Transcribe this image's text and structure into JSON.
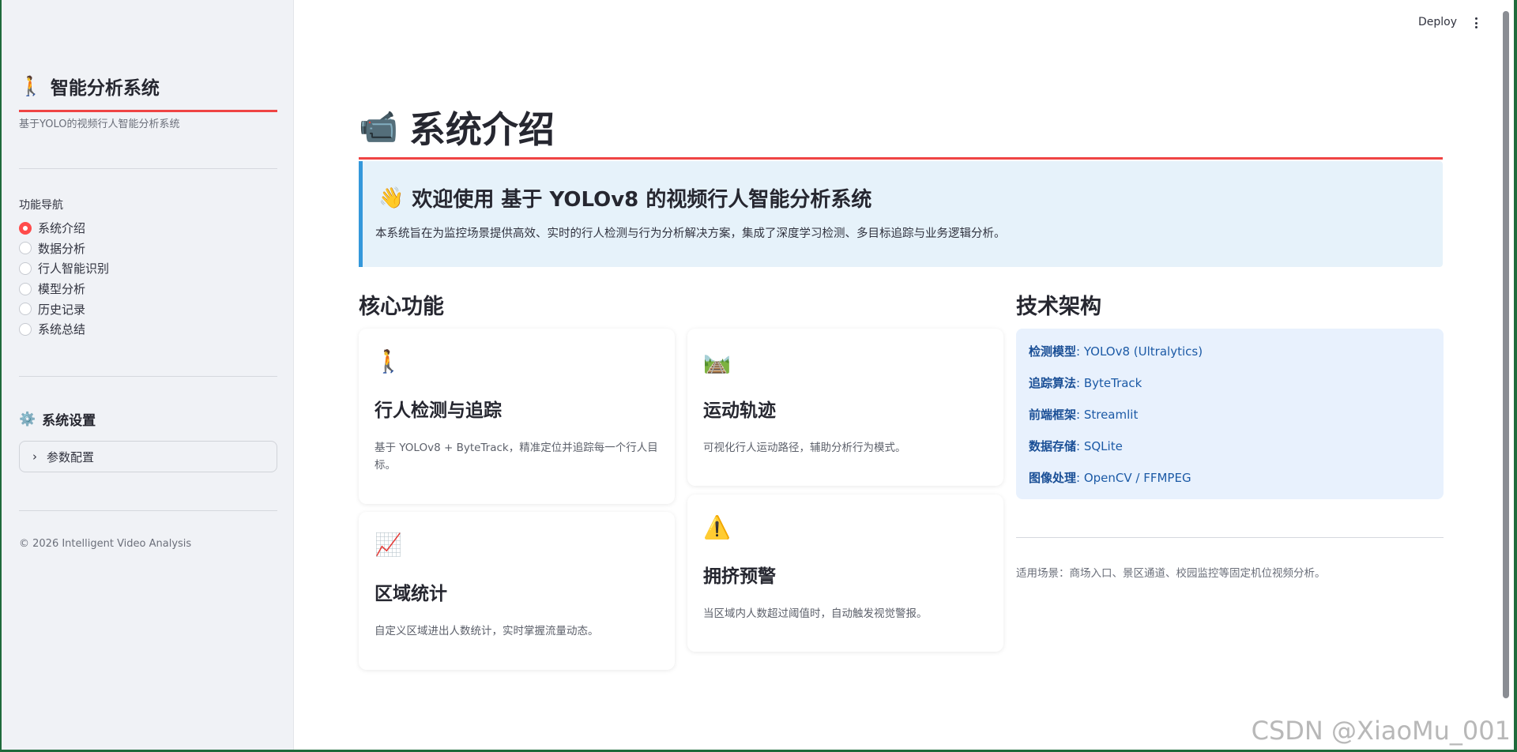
{
  "sidebar": {
    "title_emoji": "🚶",
    "title": "智能分析系统",
    "subtitle": "基于YOLO的视频行人智能分析系统",
    "nav_label": "功能导航",
    "nav_items": [
      {
        "label": "系统介绍",
        "selected": true
      },
      {
        "label": "数据分析",
        "selected": false
      },
      {
        "label": "行人智能识别",
        "selected": false
      },
      {
        "label": "模型分析",
        "selected": false
      },
      {
        "label": "历史记录",
        "selected": false
      },
      {
        "label": "系统总结",
        "selected": false
      }
    ],
    "settings_icon": "⚙️",
    "settings_title": "系统设置",
    "expander_label": "参数配置",
    "copyright": "© 2026 Intelligent Video Analysis"
  },
  "header": {
    "deploy_label": "Deploy"
  },
  "main": {
    "title_emoji": "📹",
    "title": "系统介绍",
    "welcome": {
      "emoji": "👋",
      "heading": "欢迎使用 基于 YOLOv8 的视频行人智能分析系统",
      "text": "本系统旨在为监控场景提供高效、实时的行人检测与行为分析解决方案，集成了深度学习检测、多目标追踪与业务逻辑分析。"
    },
    "core_title": "核心功能",
    "cards": [
      {
        "icon": "🚶",
        "title": "行人检测与追踪",
        "desc": "基于 YOLOv8 + ByteTrack，精准定位并追踪每一个行人目标。"
      },
      {
        "icon": "🛤️",
        "title": "运动轨迹",
        "desc": "可视化行人运动路径，辅助分析行为模式。"
      },
      {
        "icon": "📈",
        "title": "区域统计",
        "desc": "自定义区域进出人数统计，实时掌握流量动态。"
      },
      {
        "icon": "⚠️",
        "title": "拥挤预警",
        "desc": "当区域内人数超过阈值时，自动触发视觉警报。"
      }
    ],
    "tech_title": "技术架构",
    "tech_items": [
      {
        "key": "检测模型",
        "value": ": YOLOv8 (Ultralytics)"
      },
      {
        "key": "追踪算法",
        "value": ": ByteTrack"
      },
      {
        "key": "前端框架",
        "value": ": Streamlit"
      },
      {
        "key": "数据存储",
        "value": ": SQLite"
      },
      {
        "key": "图像处理",
        "value": ": OpenCV / FFMPEG"
      }
    ],
    "scenario": "适用场景：商场入口、景区通道、校园监控等固定机位视频分析。"
  },
  "watermark": "CSDN @XiaoMu_001",
  "colors": {
    "accent": "#ff4b4b",
    "title_line": "#ef4444",
    "info_border": "#3498db",
    "info_bg": "#e6f2fa",
    "tech_bg": "#e8f1fd",
    "tech_text": "#1c5aa6"
  }
}
